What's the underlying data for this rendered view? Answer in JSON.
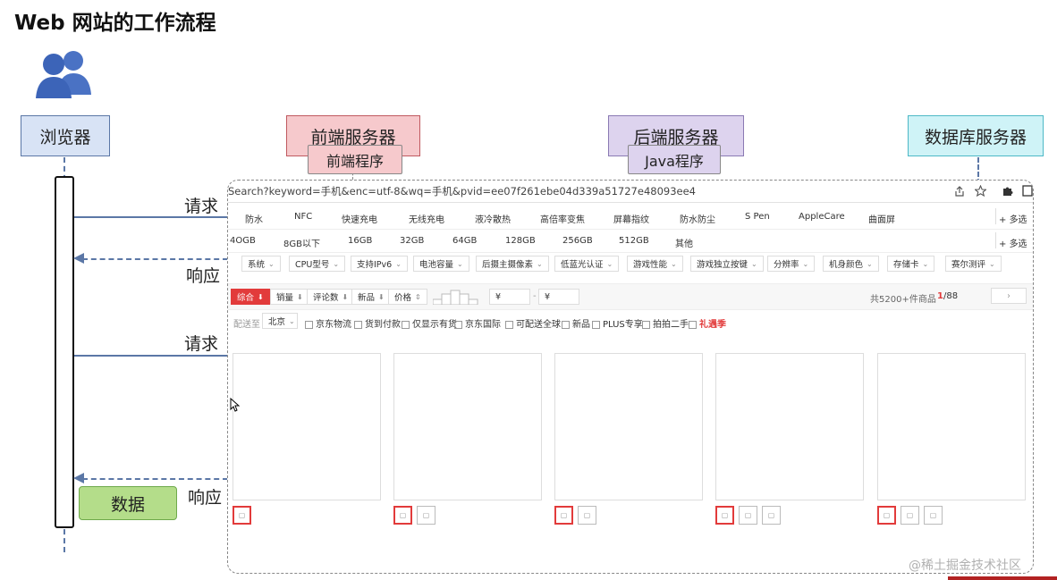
{
  "title": "Web 网站的工作流程",
  "actors": {
    "browser": "浏览器",
    "frontend": "前端服务器",
    "backend": "后端服务器",
    "database": "数据库服务器"
  },
  "programs": {
    "frontend": "前端程序",
    "backend": "Java程序"
  },
  "arrows": {
    "request1": "请求",
    "response1": "响应",
    "request2": "请求",
    "response2": "响应"
  },
  "data_label": "数据",
  "colors": {
    "browser_bg": "#d8e3f5",
    "browser_border": "#5b77a6",
    "frontend_bg": "#f6c9cc",
    "frontend_border": "#c05a60",
    "backend_bg": "#ddd3ee",
    "backend_border": "#8a7ab3",
    "database_bg": "#cff3f7",
    "database_border": "#4db8c6",
    "data_bg": "#b4dd8a",
    "data_border": "#6ea94b",
    "accent_red": "#e23b3b"
  },
  "mock": {
    "url": "Search?keyword=手机&enc=utf-8&wq=手机&pvid=ee07f261ebe04d339a51727e48093ee4",
    "features": [
      "防水",
      "NFC",
      "快速充电",
      "无线充电",
      "液冷散热",
      "高倍率变焦",
      "屏幕指纹",
      "防水防尘",
      "S Pen",
      "AppleCare",
      "曲面屏"
    ],
    "storage": [
      "4OGB",
      "8GB以下",
      "16GB",
      "32GB",
      "64GB",
      "128GB",
      "256GB",
      "512GB",
      "其他"
    ],
    "more": "多选",
    "filters": [
      "系统",
      "CPU型号",
      "支持IPv6",
      "电池容量",
      "后摄主摄像素",
      "低蓝光认证",
      "游戏性能",
      "游戏独立按键",
      "分辨率",
      "机身颜色",
      "存储卡",
      "赛尔测评"
    ],
    "sorts": [
      "综合",
      "销量",
      "评论数",
      "新品",
      "价格"
    ],
    "price_symbol": "¥",
    "total": "共5200+件商品",
    "page_current": "1",
    "page_total": "/88",
    "ship_label": "配送至",
    "ship_city": "北京",
    "options": [
      "京东物流",
      "货到付款",
      "仅显示有货",
      "京东国际",
      "可配送全球",
      "新品",
      "PLUS专享",
      "拍拍二手"
    ],
    "option_hot": "礼遇季"
  },
  "watermark": "@稀土掘金技术社区"
}
